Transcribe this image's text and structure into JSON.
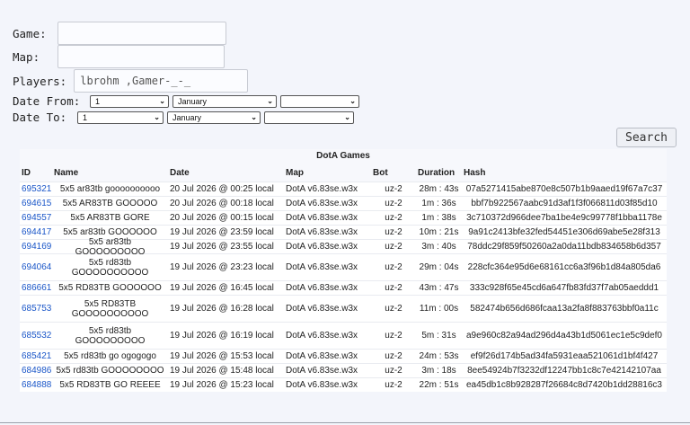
{
  "form": {
    "game_label": "Game:",
    "game_value": "",
    "map_label": "Map:",
    "map_value": "",
    "players_label": "Players:",
    "players_value": "lbrohm ,Gamer-_-_",
    "date_from_label": "Date From:",
    "date_to_label": "Date To:",
    "date_from": {
      "day": "1",
      "month": "January",
      "year": ""
    },
    "date_to": {
      "day": "1",
      "month": "January",
      "year": ""
    },
    "search_label": "Search"
  },
  "table": {
    "title": "DotA Games",
    "headers": {
      "id": "ID",
      "name": "Name",
      "date": "Date",
      "map": "Map",
      "bot": "Bot",
      "duration": "Duration",
      "hash": "Hash"
    },
    "rows": [
      {
        "id": "695321",
        "name": "5x5 ar83tb goooooooooo",
        "date": "20 Jul 2026 @ 00:25 local",
        "map": "DotA v6.83se.w3x",
        "bot": "uz-2",
        "duration": "28m : 43s",
        "hash": "07a5271415abe870e8c507b1b9aaed19f67a7c37"
      },
      {
        "id": "694615",
        "name": "5x5 AR83TB GOOOOO",
        "date": "20 Jul 2026 @ 00:18 local",
        "map": "DotA v6.83se.w3x",
        "bot": "uz-2",
        "duration": "1m : 36s",
        "hash": "bbf7b922567aabc91d3af1f3f066811d03f85d10"
      },
      {
        "id": "694557",
        "name": "5x5 AR83TB GORE",
        "date": "20 Jul 2026 @ 00:15 local",
        "map": "DotA v6.83se.w3x",
        "bot": "uz-2",
        "duration": "1m : 38s",
        "hash": "3c710372d966dee7ba1be4e9c99778f1bba1178e"
      },
      {
        "id": "694417",
        "name": "5x5 ar83tb GOOOOOO",
        "date": "19 Jul 2026 @ 23:59 local",
        "map": "DotA v6.83se.w3x",
        "bot": "uz-2",
        "duration": "10m : 21s",
        "hash": "9a91c2413bfe32fed54451e306d69abe5e28f313"
      },
      {
        "id": "694169",
        "name": "5x5 ar83tb GOOOOOOOOO",
        "date": "19 Jul 2026 @ 23:55 local",
        "map": "DotA v6.83se.w3x",
        "bot": "uz-2",
        "duration": "3m : 40s",
        "hash": "78ddc29f859f50260a2a0da11bdb834658b6d357"
      },
      {
        "id": "694064",
        "name": "5x5 rd83tb GOOOOOOOOOO",
        "date": "19 Jul 2026 @ 23:23 local",
        "map": "DotA v6.83se.w3x",
        "bot": "uz-2",
        "duration": "29m : 04s",
        "hash": "228cfc364e95d6e68161cc6a3f96b1d84a805da6"
      },
      {
        "id": "686661",
        "name": "5x5 RD83TB GOOOOOO",
        "date": "19 Jul 2026 @ 16:45 local",
        "map": "DotA v6.83se.w3x",
        "bot": "uz-2",
        "duration": "43m : 47s",
        "hash": "333c928f65e45cd6a647fb83fd37f7ab05aeddd1"
      },
      {
        "id": "685753",
        "name": "5x5 RD83TB GOOOOOOOOOO",
        "date": "19 Jul 2026 @ 16:28 local",
        "map": "DotA v6.83se.w3x",
        "bot": "uz-2",
        "duration": "11m : 00s",
        "hash": "582474b656d686fcaa13a2fa8f883763bbf0a11c"
      },
      {
        "id": "685532",
        "name": "5x5 rd83tb GOOOOOOOOO",
        "date": "19 Jul 2026 @ 16:19 local",
        "map": "DotA v6.83se.w3x",
        "bot": "uz-2",
        "duration": "5m : 31s",
        "hash": "a9e960c82a94ad296d4a43b1d5061ec1e5c9def0"
      },
      {
        "id": "685421",
        "name": "5x5 rd83tb go ogogogo",
        "date": "19 Jul 2026 @ 15:53 local",
        "map": "DotA v6.83se.w3x",
        "bot": "uz-2",
        "duration": "24m : 53s",
        "hash": "ef9f26d174b5ad34fa5931eaa521061d1bf4f427"
      },
      {
        "id": "684986",
        "name": "5x5 rd83tb GOOOOOOOO",
        "date": "19 Jul 2026 @ 15:48 local",
        "map": "DotA v6.83se.w3x",
        "bot": "uz-2",
        "duration": "3m : 18s",
        "hash": "8ee54924b7f3232df12247bb1c8c7e42142107aa"
      },
      {
        "id": "684888",
        "name": "5x5 RD83TB GO REEEE",
        "date": "19 Jul 2026 @ 15:23 local",
        "map": "DotA v6.83se.w3x",
        "bot": "uz-2",
        "duration": "22m : 51s",
        "hash": "ea45db1c8b928287f26684c8d7420b1dd28816c3"
      }
    ]
  }
}
